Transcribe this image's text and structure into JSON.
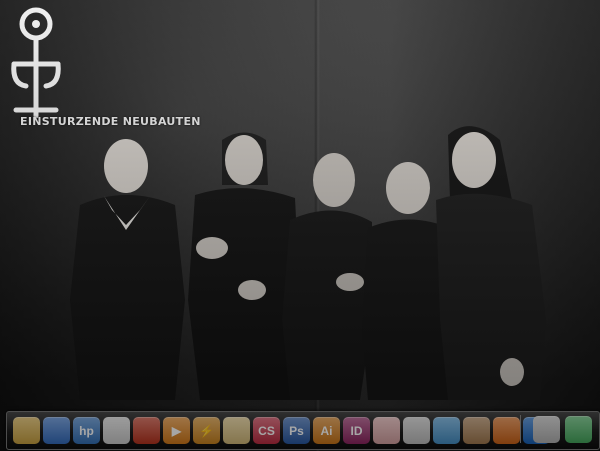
{
  "wallpaper": {
    "band_name": "EINSTURZENDE NEUBAUTEN",
    "logo_icon": "neubauten-stick-figure-icon"
  },
  "dock": {
    "items": [
      {
        "name": "folder-icon",
        "label": "",
        "color": "#e6b94a"
      },
      {
        "name": "network-globe-icon",
        "label": "",
        "color": "#3b7bd8"
      },
      {
        "name": "hp-icon",
        "label": "hp",
        "color": "#3a7fd0"
      },
      {
        "name": "mail-icon",
        "label": "",
        "color": "#e8e8e8"
      },
      {
        "name": "firefox-style-red-icon",
        "label": "",
        "color": "#d03a22"
      },
      {
        "name": "media-player-icon",
        "label": "▶",
        "color": "#ef8a1c"
      },
      {
        "name": "lightning-icon",
        "label": "⚡",
        "color": "#e39422"
      },
      {
        "name": "envelope-icon",
        "label": "",
        "color": "#efd38a"
      },
      {
        "name": "creative-suite-icon",
        "label": "CS",
        "color": "#d6324a"
      },
      {
        "name": "photoshop-icon",
        "label": "Ps",
        "color": "#2d64b8"
      },
      {
        "name": "illustrator-icon",
        "label": "Ai",
        "color": "#e5851a"
      },
      {
        "name": "indesign-icon",
        "label": "ID",
        "color": "#a12a6e"
      },
      {
        "name": "hand-icon",
        "label": "",
        "color": "#f2b8b8"
      },
      {
        "name": "fingerprint-icon",
        "label": "",
        "color": "#d8d8d8"
      },
      {
        "name": "messenger-icon",
        "label": "",
        "color": "#4fa3e0"
      },
      {
        "name": "rabbit-icon",
        "label": "",
        "color": "#b88a5a"
      },
      {
        "name": "firefox-icon",
        "label": "",
        "color": "#e8701a"
      },
      {
        "name": "app-store-icon",
        "label": "a",
        "color": "#1a6ed0"
      }
    ],
    "right_items": [
      {
        "name": "pickaxe-icon",
        "label": "",
        "color": "#cccccc"
      },
      {
        "name": "recycle-bin-icon",
        "label": "",
        "color": "#4fbf6a"
      }
    ]
  }
}
